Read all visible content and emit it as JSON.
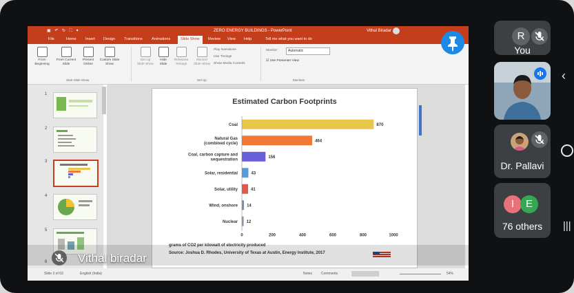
{
  "app": {
    "doc_title": "ZERO ENERGY BUILDINGS - PowerPoint",
    "user": "Vithal Biradar",
    "tabs": [
      "File",
      "Home",
      "Insert",
      "Design",
      "Transitions",
      "Animations",
      "Slide Show",
      "Review",
      "View",
      "Help",
      "Tell me what you want to do"
    ],
    "active_tab": "Slide Show"
  },
  "ribbon": {
    "from_beginning": "From Beginning",
    "from_current": "From Current Slide",
    "present_online": "Present Online",
    "custom_slide_show": "Custom Slide Show",
    "group_start": "Start Slide Show",
    "set_up": "Set Up Slide Show",
    "hide_slide": "Hide Slide",
    "rehearse": "Rehearse Timings",
    "record": "Record Slide Show",
    "play_narrations": "Play Narrations",
    "use_timings": "Use Timings",
    "show_media_controls": "Show Media Controls",
    "group_setup": "Set Up",
    "monitor_label": "Monitor:",
    "monitor_value": "Automatic",
    "presenter_view": "Use Presenter View",
    "group_monitors": "Monitors"
  },
  "thumbnails": [
    {
      "num": "1"
    },
    {
      "num": "2"
    },
    {
      "num": "3"
    },
    {
      "num": "4"
    },
    {
      "num": "5"
    },
    {
      "num": "6"
    }
  ],
  "slide": {
    "title": "Estimated Carbon Footprints",
    "note_units": "grams of CO2 per kilowatt of electricity produced",
    "source": "Source: Joshua D. Rhodes, University of Texas at Austin, Energy Institute, 2017"
  },
  "chart_data": {
    "type": "bar",
    "orientation": "horizontal",
    "title": "Estimated Carbon Footprints",
    "categories": [
      "Coal",
      "Natural Gas (combined cycle)",
      "Coal, carbon capture and sequestration",
      "Solar, residential",
      "Solar, utility",
      "Wind, onshore",
      "Nuclear"
    ],
    "values": [
      870,
      464,
      156,
      43,
      41,
      14,
      12
    ],
    "colors": [
      "#e8c64a",
      "#f07a35",
      "#6a5fd8",
      "#5b9bd5",
      "#e05a4a",
      "#7f8fa6",
      "#8e9aaa"
    ],
    "xticks": [
      0,
      200,
      400,
      600,
      800,
      1000
    ],
    "xlim": [
      0,
      1000
    ],
    "xlabel": "grams of CO2 per kilowatt of electricity produced"
  },
  "status": {
    "slide_of": "Slide 3 of 63",
    "language": "English (India)",
    "notes": "Notes",
    "comments": "Comments",
    "zoom": "54%"
  },
  "meet": {
    "presenter_name": "Vithal biradar",
    "you_initial": "R",
    "you_label": "You",
    "tile2_name": "Dr. Pallavi",
    "others_initials": [
      "I",
      "E"
    ],
    "others_label": "76 others",
    "colors": {
      "you_avatar": "#5f6368",
      "i_avatar": "#e8717a",
      "e_avatar": "#34a853",
      "pin": "#1e88e5"
    }
  }
}
